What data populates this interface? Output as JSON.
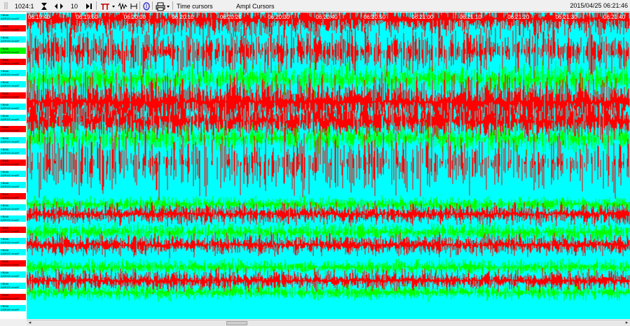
{
  "toolbar": {
    "ratio": "1024:1",
    "zoom_value": "10",
    "time_cursors": "Time cursors",
    "ampl_cursors": "Ampl Cursors",
    "datetime": "2015/04/25 06:21:46"
  },
  "time_ticks": [
    "06:19:40",
    "06:19:50",
    "06:20:00",
    "06:20:10",
    "06:20:20",
    "06:20:30",
    "06:20:40",
    "06:20:50",
    "06:21:00",
    "06:21:10",
    "06:21:20",
    "06:21:30",
    "06:21:40"
  ],
  "channels": [
    {
      "name": "YBMA",
      "unit": "ADRI20 mm/s²",
      "color": "#00ffff"
    },
    {
      "name": "YBMA",
      "unit": "ADRI20 mm/s²",
      "color": "#ff0000"
    },
    {
      "name": "YBMA",
      "unit": "ADRI40 mm/s²",
      "color": "#00ffff"
    },
    {
      "name": "YBMA",
      "unit": "ADRI20 mm/s²",
      "color": "#00ff00"
    },
    {
      "name": "YBMA",
      "unit": "ADRI40 mm/s²",
      "color": "#ff0000"
    },
    {
      "name": "YBMA",
      "unit": "ADRI40 mm/s²",
      "color": "#00ffff"
    },
    {
      "name": "YBMA",
      "unit": "ADRI20 mm/s²",
      "color": "#00ffff"
    },
    {
      "name": "YBMA",
      "unit": "ADRI20 mm/s²",
      "color": "#ff0000"
    },
    {
      "name": "YBMA",
      "unit": "ADRI40 mm/s²",
      "color": "#00ffff"
    },
    {
      "name": "YBMA",
      "unit": "ADRI20 mm/s²",
      "color": "#00ffff"
    },
    {
      "name": "YBMA",
      "unit": "ADRI40 mm/s²",
      "color": "#ff0000"
    },
    {
      "name": "YBMA",
      "unit": "ADRI20 mm/s²",
      "color": "#00ffff"
    },
    {
      "name": "YBMA",
      "unit": "ADRI20 mm/s²",
      "color": "#00ffff"
    },
    {
      "name": "YBMA",
      "unit": "ADRI40 mm/s²",
      "color": "#ff0000"
    },
    {
      "name": "YBMA",
      "unit": "ADRI40 mm/s²",
      "color": "#00ffff"
    },
    {
      "name": "YBMA",
      "unit": "ADRI20 mm/s²",
      "color": "#00ffff"
    },
    {
      "name": "YBMA",
      "unit": "ADRI40 mm/s²",
      "color": "#ff0000"
    },
    {
      "name": "YBMA",
      "unit": "ADRI40 mm/s²",
      "color": "#00ffff"
    },
    {
      "name": "YBMA",
      "unit": "ADRI20 mm/s²",
      "color": "#00ffff"
    },
    {
      "name": "YBMA",
      "unit": "ADRI20 mm/s²",
      "color": "#ff0000"
    },
    {
      "name": "YBMA",
      "unit": "ADRI40 mm/s²",
      "color": "#00ffff"
    },
    {
      "name": "YBMA",
      "unit": "ADRI20 mm/s²",
      "color": "#00ffff"
    },
    {
      "name": "YBMA",
      "unit": "ADRI20 mm/s²",
      "color": "#ff0000"
    },
    {
      "name": "YBMA",
      "unit": "ADRI40 mm/s²",
      "color": "#00ffff"
    },
    {
      "name": "YBMA",
      "unit": "ADRI20 mm/s²",
      "color": "#00ffff"
    },
    {
      "name": "YBMA",
      "unit": "ADRI40 mm/s²",
      "color": "#ff0000"
    },
    {
      "name": "YBMA",
      "unit": "ADRI40 mm/s²",
      "color": "#00ffff"
    }
  ],
  "colors": {
    "cyan": "#00ffff",
    "red": "#ff0000",
    "green": "#00ff00"
  }
}
